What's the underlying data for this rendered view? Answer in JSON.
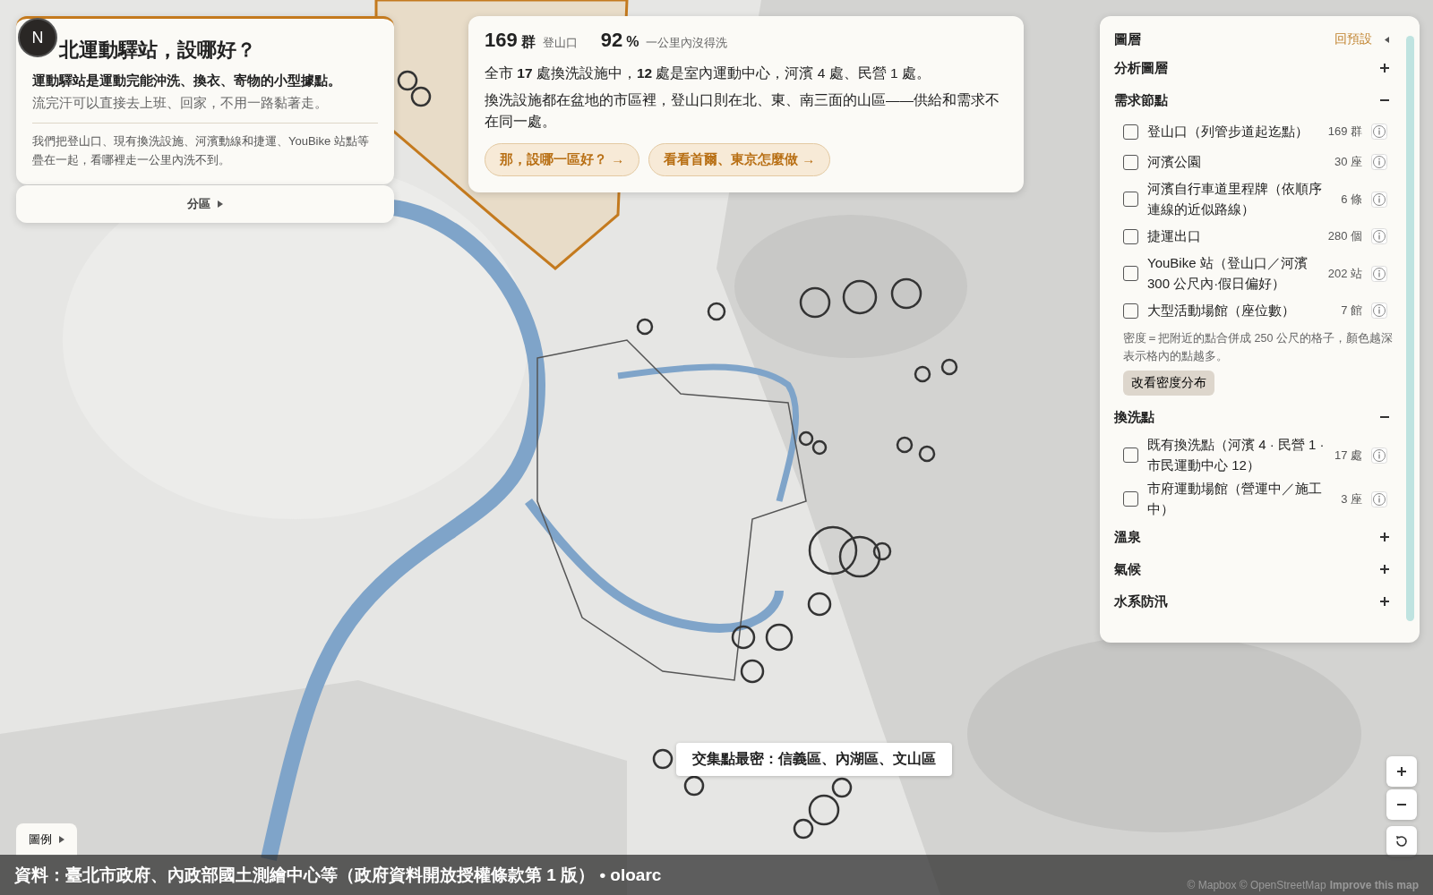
{
  "app_badge": {
    "letter": "N"
  },
  "intro": {
    "title": "北運動驛站，設哪好？",
    "lead": "運動驛站是運動完能沖洗、換衣、寄物的小型據點。",
    "sub": "流完汗可以直接去上班、回家，不用一路黏著走。",
    "note": "我們把登山口、現有換洗設施、河濱動線和捷運、YouBike 站點等疊在一起，看哪裡走一公里內洗不到。"
  },
  "district_toggle": {
    "label": "分區"
  },
  "summary": {
    "stats": [
      {
        "value": "169",
        "unit": "群",
        "label": "登山口"
      },
      {
        "value": "92",
        "unit": "%",
        "label": "一公里內沒得洗"
      }
    ],
    "paragraphs": [
      "全市 **17** 處換洗設施中，**12** 處是室內運動中心，河濱 4 處、民營 1 處。",
      "換洗設施都在盆地的市區裡，登山口則在北、東、南三面的山區——供給和需求不在同一處。"
    ],
    "actions": [
      "那，設哪一區好？ →",
      "看看首爾、東京怎麼做 →"
    ]
  },
  "layers": {
    "title": "圖層",
    "reset": "回預設",
    "sections": [
      {
        "title": "分析圖層",
        "expanded": false
      },
      {
        "title": "需求節點",
        "expanded": true,
        "items": [
          {
            "label": "登山口（列管步道起迄點）",
            "count": "169 群",
            "checked": false
          },
          {
            "label": "河濱公園",
            "count": "30 座",
            "checked": false
          },
          {
            "label": "河濱自行車道里程牌（依順序連線的近似路線）",
            "count": "6 條",
            "checked": false
          },
          {
            "label": "捷運出口",
            "count": "280 個",
            "checked": false
          },
          {
            "label": "YouBike 站（登山口／河濱 300 公尺內·假日偏好）",
            "count": "202 站",
            "checked": false
          },
          {
            "label": "大型活動場館（座位數）",
            "count": "7 館",
            "checked": false
          }
        ],
        "note": "密度＝把附近的點合併成 250 公尺的格子，顏色越深表示格內的點越多。",
        "button": "改看密度分布"
      },
      {
        "title": "換洗點",
        "expanded": true,
        "items": [
          {
            "label": "既有換洗點（河濱 4 · 民營 1 · 市民運動中心 12）",
            "count": "17 處",
            "checked": false
          },
          {
            "label": "市府運動場館（營運中／施工中）",
            "count": "3 座",
            "checked": false
          }
        ]
      },
      {
        "title": "溫泉",
        "expanded": false
      },
      {
        "title": "氣候",
        "expanded": false
      },
      {
        "title": "水系防汛",
        "expanded": false
      }
    ]
  },
  "map_tooltip": "交集點最密：信義區、內湖區、文山區",
  "legend_button": "圖例",
  "footer": {
    "source": "資料：臺北市政府、內政部國土測繪中心等（政府資料開放授權條款第 1 版） • oloarc",
    "attribution": "© Mapbox © OpenStreetMap",
    "improve_link": "Improve this map"
  }
}
